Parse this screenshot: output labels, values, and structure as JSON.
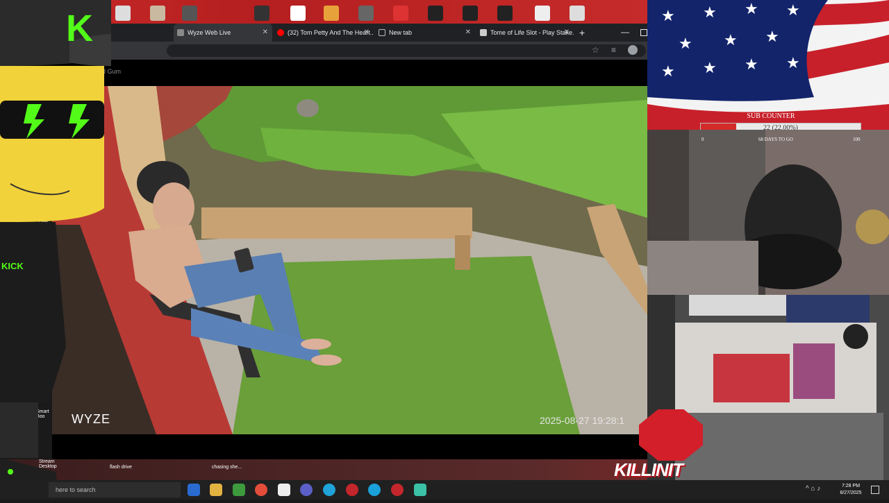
{
  "browser": {
    "tabs": [
      {
        "label": "Wyze Web Live",
        "active": true
      },
      {
        "label": "(32) Tom Petty And The Heart...",
        "active": false
      },
      {
        "label": "New tab",
        "active": false
      },
      {
        "label": "Tome of Life Slot - Play Stake...",
        "active": false
      }
    ],
    "new_tab_label": "+",
    "close_glyph": "✕"
  },
  "camera": {
    "header_text": "ulld Gum",
    "brand": "WYZE",
    "timestamp": "2025-08-27 19:28:1"
  },
  "overlay": {
    "logo_letter": "K",
    "shirt_text": "KICK",
    "sponsor_logo": "KILLINIT"
  },
  "sub_counter": {
    "title": "SUB COUNTER",
    "value_text": "22 (22.00%)",
    "progress_fraction": 0.22,
    "days_text": "68 DAYS TO GO",
    "min_label": "0",
    "max_label": "100"
  },
  "desktop_icons": [
    {
      "label": "Logi"
    },
    {
      "label": "Smart Boo"
    },
    {
      "label": "Stream Desktop"
    },
    {
      "label": "flash drive"
    },
    {
      "label": "chasing she..."
    }
  ],
  "taskbar": {
    "search_placeholder": "here to search",
    "time": "7:28 PM",
    "date": "8/27/2025"
  },
  "colors": {
    "accent_red": "#d42a2a",
    "kick_green": "#53fc18",
    "chrome_dark": "#202124"
  }
}
